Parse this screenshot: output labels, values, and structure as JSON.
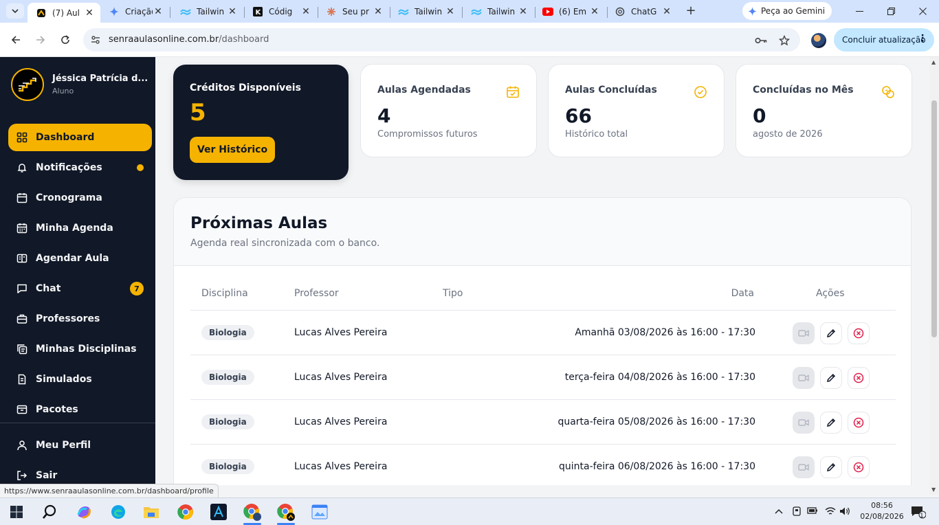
{
  "browser": {
    "tabs": [
      {
        "title": "(7) Aul",
        "active": true
      },
      {
        "title": "Criação"
      },
      {
        "title": "Tailwin"
      },
      {
        "title": "Códig"
      },
      {
        "title": "Seu pr"
      },
      {
        "title": "Tailwin"
      },
      {
        "title": "Tailwin"
      },
      {
        "title": "(6) Em"
      },
      {
        "title": "ChatG"
      }
    ],
    "gemini_label": "Peça ao Gemini",
    "url_host": "senraaulasonline.com.br",
    "url_path": "/dashboard",
    "update_label": "Concluir atualização",
    "status_url": "https://www.senraaulasonline.com.br/dashboard/profile"
  },
  "user": {
    "name": "Jéssica Patrícia d...",
    "role": "Aluno"
  },
  "sidebar": {
    "items": [
      {
        "label": "Dashboard",
        "icon": "dashboard-icon",
        "active": true
      },
      {
        "label": "Notificações",
        "icon": "bell-icon",
        "dot": true
      },
      {
        "label": "Cronograma",
        "icon": "calendar-icon"
      },
      {
        "label": "Minha Agenda",
        "icon": "calendar-icon"
      },
      {
        "label": "Agendar Aula",
        "icon": "book-open-icon"
      },
      {
        "label": "Chat",
        "icon": "chat-icon",
        "badge": "7"
      },
      {
        "label": "Professores",
        "icon": "briefcase-icon"
      },
      {
        "label": "Minhas Disciplinas",
        "icon": "copy-icon"
      },
      {
        "label": "Simulados",
        "icon": "clipboard-icon"
      },
      {
        "label": "Pacotes",
        "icon": "package-icon"
      },
      {
        "label": "Meu Perfil",
        "icon": "user-icon"
      },
      {
        "label": "Sair",
        "icon": "logout-icon"
      }
    ]
  },
  "credits": {
    "title": "Créditos Disponíveis",
    "value": "5",
    "button": "Ver Histórico"
  },
  "stats": [
    {
      "title": "Aulas Agendadas",
      "value": "4",
      "subtitle": "Compromissos futuros",
      "icon": "calendar-check-icon"
    },
    {
      "title": "Aulas Concluídas",
      "value": "66",
      "subtitle": "Histórico total",
      "icon": "check-circle-icon"
    },
    {
      "title": "Concluídas no Mês",
      "value": "0",
      "subtitle": "agosto de 2026",
      "icon": "coins-icon"
    }
  ],
  "lessons": {
    "title": "Próximas Aulas",
    "subtitle": "Agenda real sincronizada com o banco.",
    "columns": {
      "discipline": "Disciplina",
      "teacher": "Professor",
      "type": "Tipo",
      "date": "Data",
      "actions": "Ações"
    },
    "rows": [
      {
        "discipline": "Biologia",
        "teacher": "Lucas Alves Pereira",
        "type": "",
        "date": "Amanhã 03/08/2026 às 16:00 - 17:30"
      },
      {
        "discipline": "Biologia",
        "teacher": "Lucas Alves Pereira",
        "type": "",
        "date": "terça-feira 04/08/2026 às 16:00 - 17:30"
      },
      {
        "discipline": "Biologia",
        "teacher": "Lucas Alves Pereira",
        "type": "",
        "date": "quarta-feira 05/08/2026 às 16:00 - 17:30"
      },
      {
        "discipline": "Biologia",
        "teacher": "Lucas Alves Pereira",
        "type": "",
        "date": "quinta-feira 06/08/2026 às 16:00 - 17:30"
      }
    ]
  },
  "taskbar": {
    "time": "08:56",
    "date": "02/08/2026",
    "notification_count": "1"
  },
  "colors": {
    "accent": "#f5b300",
    "sidebar": "#111827",
    "danger": "#e11d48"
  }
}
